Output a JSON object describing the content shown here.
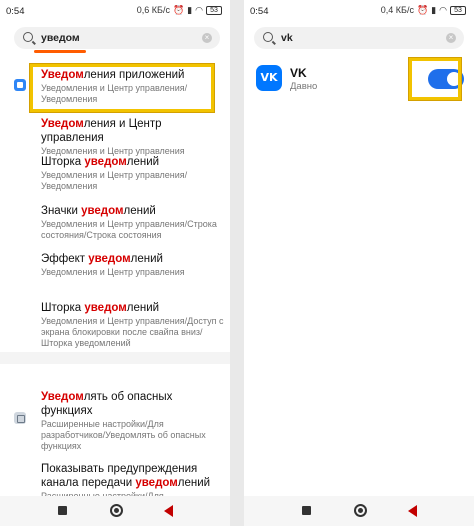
{
  "left": {
    "status": {
      "time": "0:54",
      "speed": "0,6 КБ/с",
      "battery": "53"
    },
    "search": {
      "query": "уведом"
    },
    "results": [
      {
        "hl": "Уведом",
        "rest": "ления приложений",
        "sub": "Уведомления и Центр управления/ Уведомления"
      },
      {
        "hl": "Уведом",
        "rest": "ления и Центр управления",
        "sub": "Уведомления и Центр управления"
      },
      {
        "pre": "Шторка ",
        "hl": "уведом",
        "rest": "лений",
        "sub": "Уведомления и Центр управления/ Уведомления"
      },
      {
        "pre": "Значки ",
        "hl": "уведом",
        "rest": "лений",
        "sub": "Уведомления и Центр управления/Строка состояния/Строка состояния"
      },
      {
        "pre": "Эффект ",
        "hl": "уведом",
        "rest": "лений",
        "sub": "Уведомления и Центр управления"
      },
      {
        "pre": "Шторка ",
        "hl": "уведом",
        "rest": "лений",
        "sub": "Уведомления и Центр управления/Доступ с экрана блокировки после свайпа вниз/ Шторка уведомлений"
      },
      {
        "hl": "Уведом",
        "rest": "лять об опасных функциях",
        "sub": "Расширенные настройки/Для разработчиков/Уведомлять об опасных функциях"
      },
      {
        "pre": "Показывать предупреждения канала передачи ",
        "hl": "уведом",
        "rest": "лений",
        "sub": "Расширенные настройки/Для"
      }
    ]
  },
  "right": {
    "status": {
      "time": "0:54",
      "speed": "0,4 КБ/с",
      "battery": "53"
    },
    "search": {
      "query": "vk"
    },
    "app": {
      "logo": "VK",
      "name": "VK",
      "subtitle": "Давно",
      "toggle_on": true
    }
  },
  "icons": {
    "search": "search-icon",
    "clear": "clear-icon",
    "notifications_section": "notifications-section-icon",
    "developer_section": "developer-section-icon",
    "recents": "recents-icon",
    "home": "home-icon",
    "back": "back-icon"
  },
  "colors": {
    "highlight_text": "#d60000",
    "annotation_box": "#f2c300",
    "toggle_on": "#1f6feb",
    "vk_brand": "#0077ff"
  }
}
